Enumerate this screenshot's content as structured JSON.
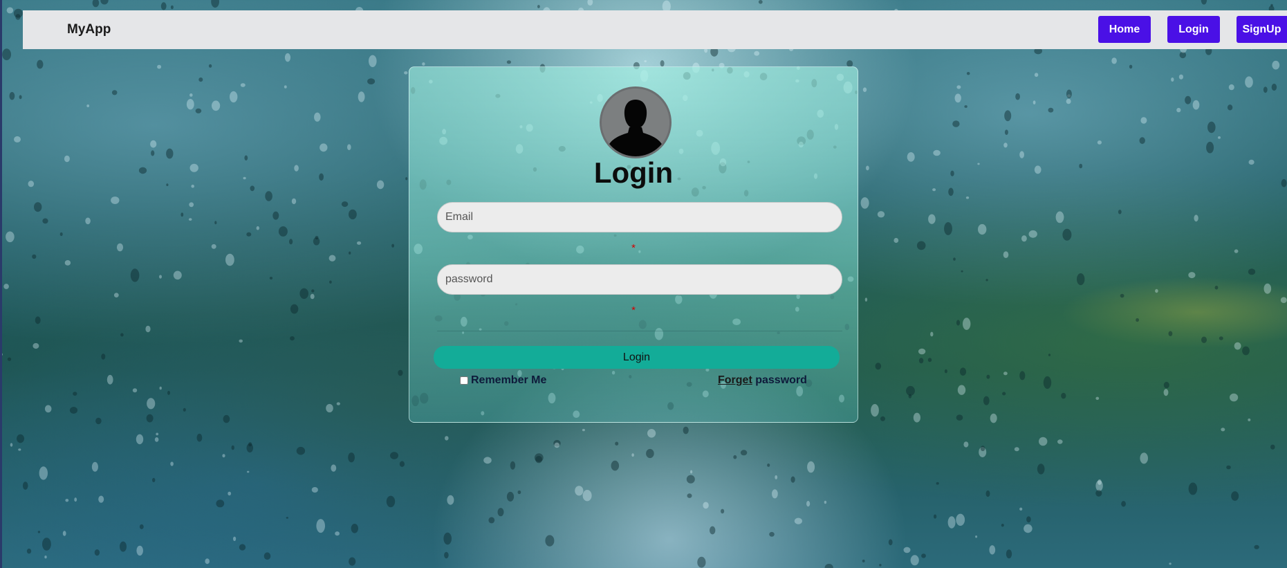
{
  "navbar": {
    "brand": "MyApp",
    "links": [
      {
        "label": "Home"
      },
      {
        "label": "Login"
      },
      {
        "label": "SignUp"
      }
    ],
    "link_color": "#4a10e6"
  },
  "form": {
    "title": "Login",
    "email": {
      "placeholder": "Email",
      "value": "",
      "required_mark": "*"
    },
    "password": {
      "placeholder": "password",
      "value": "",
      "required_mark": "*"
    },
    "submit_label": "Login",
    "remember_label": "Remember Me",
    "remember_checked": false,
    "forget_link": "Forget",
    "forget_rest": "password",
    "submit_color": "#13ac98"
  },
  "icons": {
    "avatar": "user-silhouette-icon"
  }
}
